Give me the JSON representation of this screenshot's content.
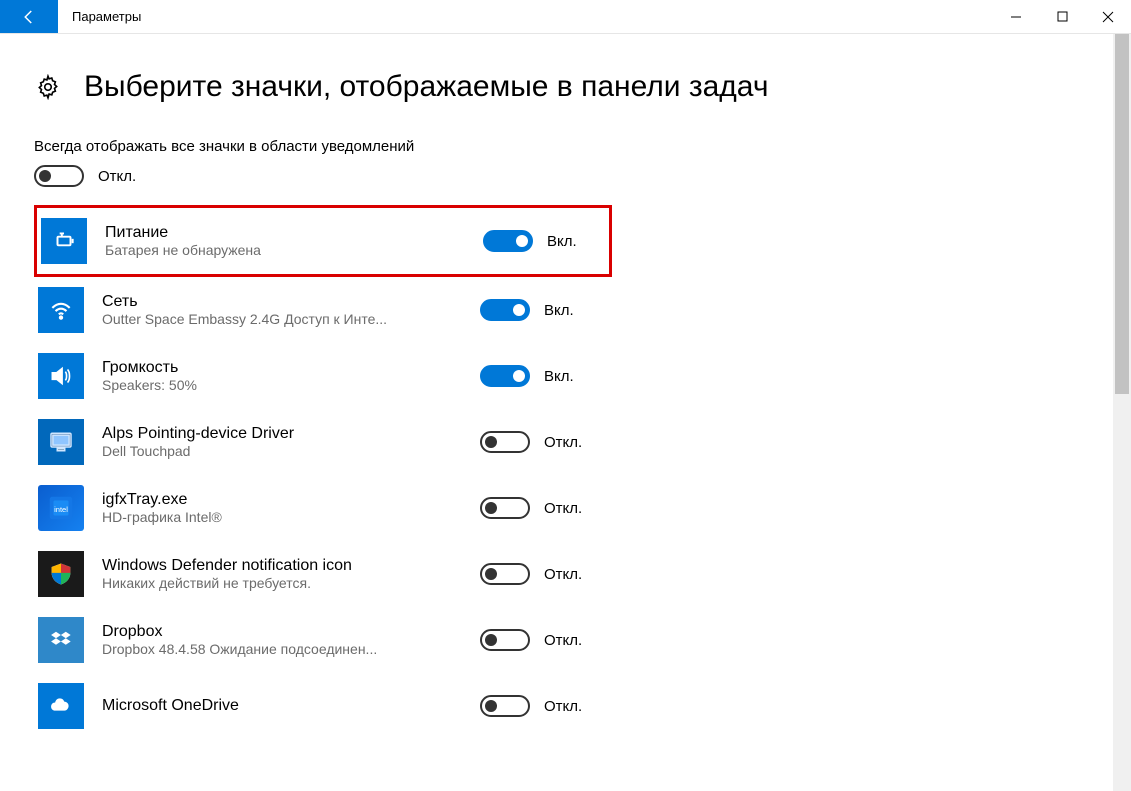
{
  "window": {
    "title": "Параметры"
  },
  "header": {
    "title": "Выберите значки, отображаемые в панели задач"
  },
  "master": {
    "label": "Всегда отображать все значки в области уведомлений",
    "state_text": "Откл.",
    "state": "off"
  },
  "state_labels": {
    "on": "Вкл.",
    "off": "Откл."
  },
  "items": [
    {
      "title": "Питание",
      "sub": "Батарея не обнаружена",
      "state": "on",
      "icon": "power-icon",
      "highlight": true
    },
    {
      "title": "Сеть",
      "sub": "Outter Space Embassy 2.4G Доступ к Инте...",
      "state": "on",
      "icon": "wifi-icon",
      "highlight": false
    },
    {
      "title": "Громкость",
      "sub": "Speakers: 50%",
      "state": "on",
      "icon": "volume-icon",
      "highlight": false
    },
    {
      "title": "Alps Pointing-device Driver",
      "sub": "Dell Touchpad",
      "state": "off",
      "icon": "monitor-icon",
      "highlight": false
    },
    {
      "title": "igfxTray.exe",
      "sub": "HD-графика Intel®",
      "state": "off",
      "icon": "intel-icon",
      "highlight": false
    },
    {
      "title": "Windows Defender notification icon",
      "sub": "Никаких действий не требуется.",
      "state": "off",
      "icon": "defender-icon",
      "highlight": false
    },
    {
      "title": "Dropbox",
      "sub": "Dropbox 48.4.58 Ожидание подсоединен...",
      "state": "off",
      "icon": "dropbox-icon",
      "highlight": false
    },
    {
      "title": "Microsoft OneDrive",
      "sub": "",
      "state": "off",
      "icon": "onedrive-icon",
      "highlight": false
    }
  ]
}
